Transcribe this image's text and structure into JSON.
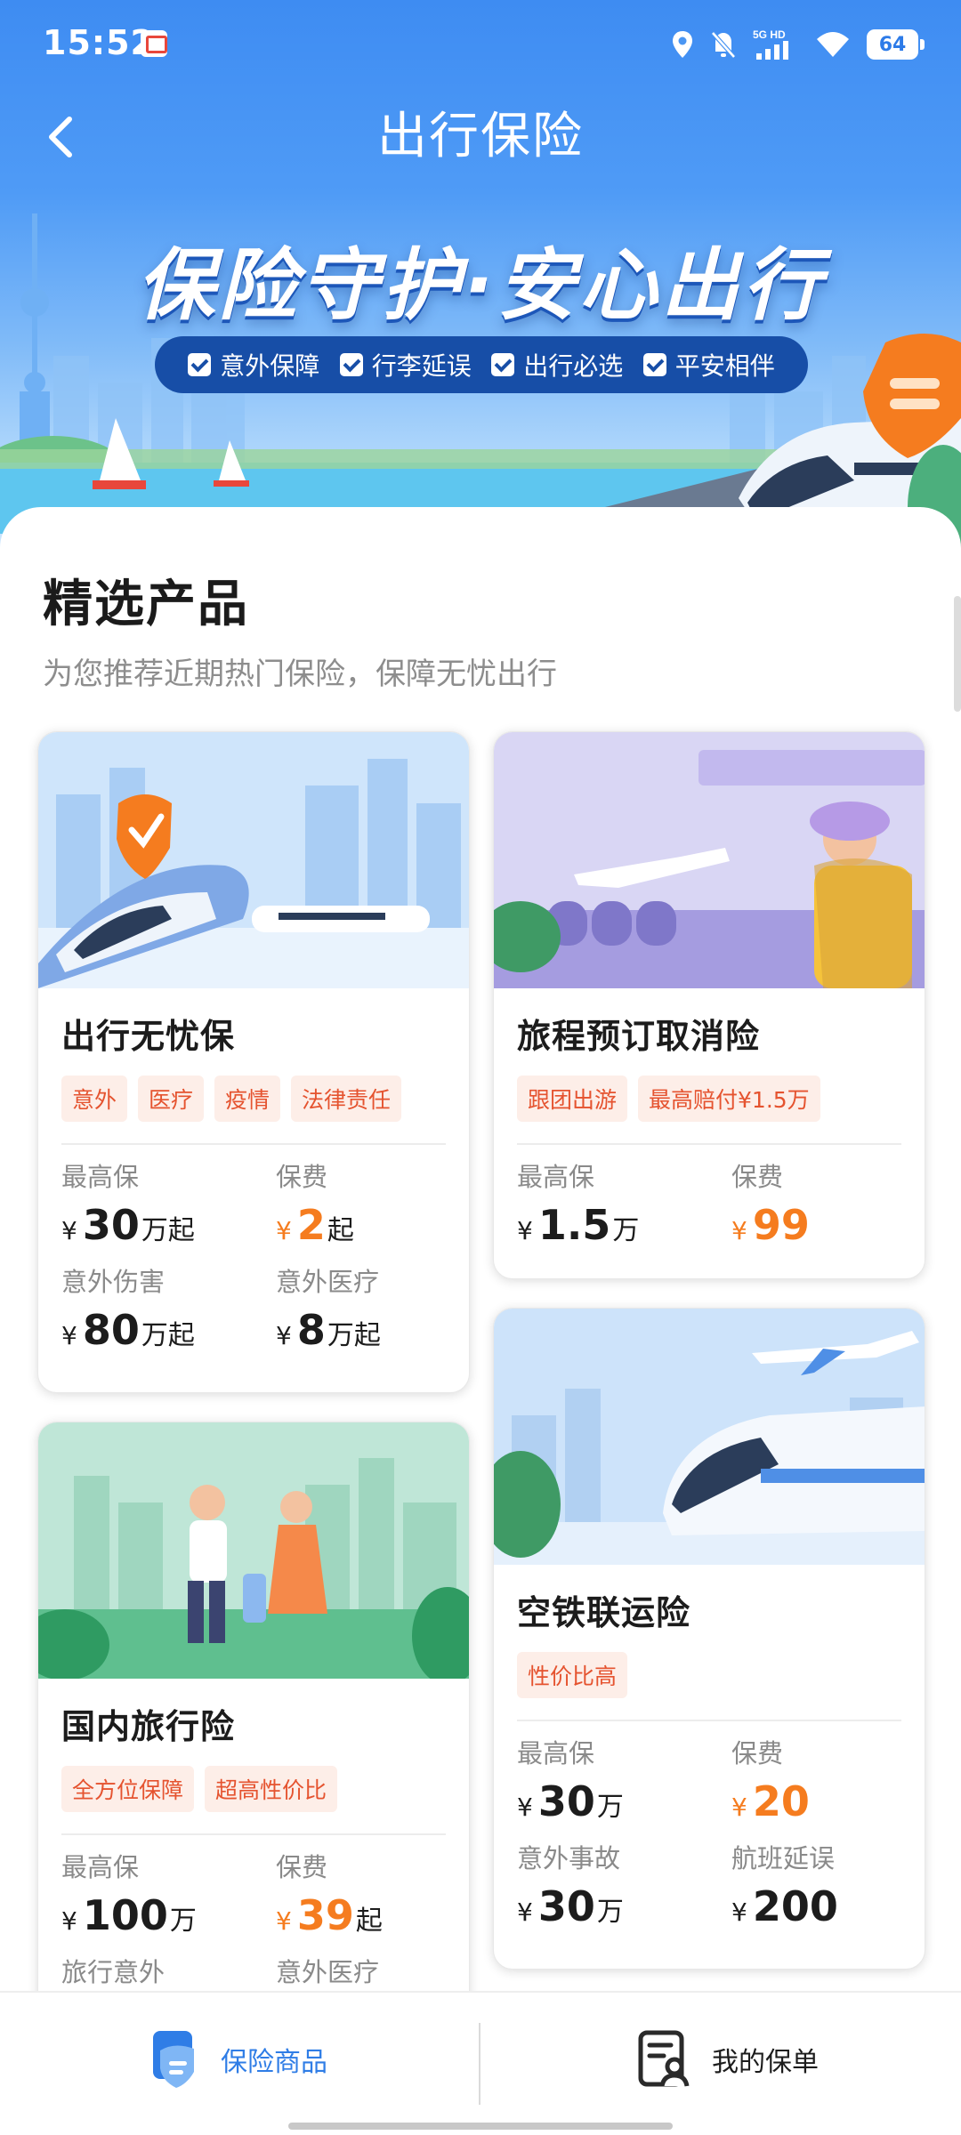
{
  "status_bar": {
    "time": "15:52",
    "network": "5G HD",
    "battery": "64"
  },
  "nav": {
    "title": "出行保险"
  },
  "banner": {
    "slogan": "保险守护·安心出行",
    "features": [
      "意外保障",
      "行李延误",
      "出行必选",
      "平安相伴"
    ]
  },
  "section": {
    "title": "精选产品",
    "subtitle": "为您推荐近期热门保险，保障无忧出行"
  },
  "products": [
    {
      "name": "出行无忧保",
      "tags": [
        "意外",
        "医疗",
        "疫情",
        "法律责任"
      ],
      "stats": [
        {
          "label": "最高保",
          "currency": "¥",
          "value": "30",
          "unit": "万起"
        },
        {
          "label": "保费",
          "currency": "¥",
          "value": "2",
          "unit": "起"
        },
        {
          "label": "意外伤害",
          "currency": "¥",
          "value": "80",
          "unit": "万起"
        },
        {
          "label": "意外医疗",
          "currency": "¥",
          "value": "8",
          "unit": "万起"
        }
      ]
    },
    {
      "name": "旅程预订取消险",
      "tags": [
        "跟团出游",
        "最高赔付¥1.5万"
      ],
      "stats": [
        {
          "label": "最高保",
          "currency": "¥",
          "value": "1.5",
          "unit": "万"
        },
        {
          "label": "保费",
          "currency": "¥",
          "value": "99",
          "unit": ""
        }
      ]
    },
    {
      "name": "国内旅行险",
      "tags": [
        "全方位保障",
        "超高性价比"
      ],
      "stats": [
        {
          "label": "最高保",
          "currency": "¥",
          "value": "100",
          "unit": "万"
        },
        {
          "label": "保费",
          "currency": "¥",
          "value": "39",
          "unit": "起"
        },
        {
          "label": "旅行意外",
          "currency": "",
          "value": "",
          "unit": ""
        },
        {
          "label": "意外医疗",
          "currency": "",
          "value": "",
          "unit": ""
        }
      ]
    },
    {
      "name": "空铁联运险",
      "tags": [
        "性价比高"
      ],
      "stats": [
        {
          "label": "最高保",
          "currency": "¥",
          "value": "30",
          "unit": "万"
        },
        {
          "label": "保费",
          "currency": "¥",
          "value": "20",
          "unit": ""
        },
        {
          "label": "意外事故",
          "currency": "¥",
          "value": "30",
          "unit": "万"
        },
        {
          "label": "航班延误",
          "currency": "¥",
          "value": "200",
          "unit": ""
        }
      ]
    }
  ],
  "bottom_tabs": [
    {
      "label": "保险商品",
      "icon": "shield-doc-icon",
      "active": true
    },
    {
      "label": "我的保单",
      "icon": "policy-user-icon",
      "active": false
    }
  ],
  "colors": {
    "primary": "#3e8cf2",
    "accent": "#f57c1f",
    "tag_text": "#e5532f",
    "tag_bg": "#fdeee8",
    "active_tab": "#2f7de6"
  }
}
